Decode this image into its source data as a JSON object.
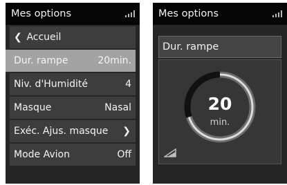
{
  "screen_menu": {
    "title": "Mes options",
    "icons": {
      "signal": "signal-icon",
      "back": "chevron-left-icon",
      "more": "chevron-right-icon"
    },
    "items": [
      {
        "label": "Accueil",
        "value": ""
      },
      {
        "label": "Dur. rampe",
        "value": "20min."
      },
      {
        "label": "Niv. d'Humidité",
        "value": "4"
      },
      {
        "label": "Masque",
        "value": "Nasal"
      },
      {
        "label": "Exéc. Ajus. masque",
        "value": ""
      },
      {
        "label": "Mode Avion",
        "value": "Off"
      }
    ],
    "selected_item": "Dur. rampe"
  },
  "screen_detail": {
    "title": "Mes options",
    "setting_label": "Dur. rampe",
    "value": "20",
    "unit": "min.",
    "dial": {
      "fill_fraction": 0.7
    },
    "icons": {
      "signal": "signal-icon",
      "corner": "corner-triangle-icon"
    }
  },
  "colors": {
    "header": "#050505",
    "screen_bg": "#262626",
    "item_bg": "#3d3d3d",
    "item_active_bg": "#a3a3a3",
    "dial_track": "#6e6e6e",
    "dial_fill": "#111111",
    "text": "#f4f4f4"
  }
}
